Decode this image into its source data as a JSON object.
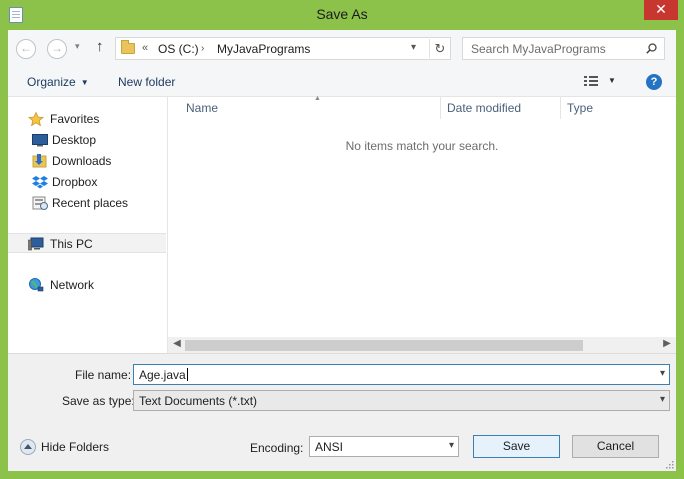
{
  "window": {
    "title": "Save As",
    "close_glyph": "✕"
  },
  "address_bar": {
    "overflow_chevron": "«",
    "crumbs": [
      "OS (C:)",
      "MyJavaPrograms"
    ],
    "crumb_separator": "›",
    "refresh_glyph": "↻"
  },
  "search": {
    "placeholder": "Search MyJavaPrograms"
  },
  "toolbar": {
    "organize_label": "Organize",
    "new_folder_label": "New folder",
    "help_glyph": "?"
  },
  "nav_pane": {
    "favorites_label": "Favorites",
    "items": [
      {
        "label": "Desktop",
        "icon": "desktop-icon"
      },
      {
        "label": "Downloads",
        "icon": "downloads-icon"
      },
      {
        "label": "Dropbox",
        "icon": "dropbox-icon"
      },
      {
        "label": "Recent places",
        "icon": "recent-places-icon"
      }
    ],
    "this_pc_label": "This PC",
    "network_label": "Network"
  },
  "file_list": {
    "columns": [
      "Name",
      "Date modified",
      "Type"
    ],
    "empty_message": "No items match your search."
  },
  "form": {
    "file_name_label": "File name:",
    "file_name_value": "Age.java",
    "save_type_label": "Save as type:",
    "save_type_value": "Text Documents (*.txt)",
    "hide_folders_label": "Hide Folders",
    "encoding_label": "Encoding:",
    "encoding_value": "ANSI",
    "save_label": "Save",
    "cancel_label": "Cancel"
  },
  "colors": {
    "frame": "#8cc24a",
    "close": "#c7372f",
    "link": "#1e3c63",
    "accent": "#3c7fb1"
  }
}
